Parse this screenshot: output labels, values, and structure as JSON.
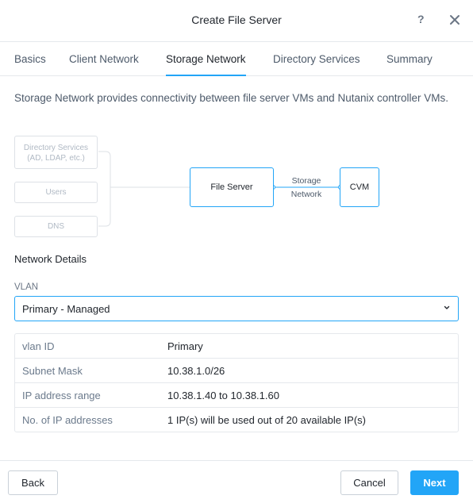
{
  "header": {
    "title": "Create File Server",
    "help_label": "?"
  },
  "tabs": [
    {
      "label": "Basics"
    },
    {
      "label": "Client Network"
    },
    {
      "label": "Storage Network"
    },
    {
      "label": "Directory Services"
    },
    {
      "label": "Summary"
    }
  ],
  "active_tab": "Storage Network",
  "intro": "Storage Network provides connectivity between file server VMs and Nutanix controller VMs.",
  "diagram": {
    "directory_services": [
      "Directory Services",
      "(AD, LDAP, etc.)"
    ],
    "users": "Users",
    "dns": "DNS",
    "file_server": "File Server",
    "storage_network": [
      "Storage",
      "Network"
    ],
    "cvm": "CVM"
  },
  "network_details": {
    "title": "Network Details",
    "vlan_label": "VLAN",
    "vlan_value": "Primary - Managed",
    "rows": [
      {
        "key": "vlan ID",
        "value": "Primary"
      },
      {
        "key": "Subnet Mask",
        "value": "10.38.1.0/26"
      },
      {
        "key": "IP address range",
        "value": "10.38.1.40 to 10.38.1.60"
      },
      {
        "key": "No. of IP addresses",
        "value": "1 IP(s) will be used out of 20 available IP(s)"
      }
    ]
  },
  "footer": {
    "back_label": "Back",
    "cancel_label": "Cancel",
    "next_label": "Next"
  },
  "colors": {
    "accent": "#22a5f7",
    "text": "#22272e",
    "muted": "#6b7a8c",
    "border": "#e5e8ec"
  }
}
